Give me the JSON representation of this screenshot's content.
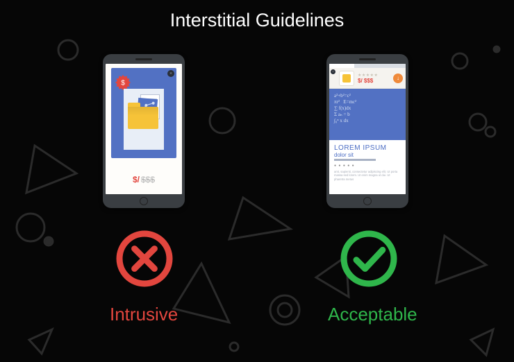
{
  "title": "Interstitial Guidelines",
  "intrusive": {
    "label": "Intrusive",
    "price_prefix": "$/",
    "price_struck": "$$$",
    "badge_symbol": "$"
  },
  "acceptable": {
    "label": "Acceptable",
    "banner_price": "$/ $$$",
    "banner_stars": "★★★★★",
    "headline": "LOREM IPSUM",
    "subhead": "dolor sit",
    "body": "amt, sapienti, consectetur adipiscing elit. Ut porta massa sed lorem. Ut enim magna ut dui. Ut pharetra metus",
    "chalk_lines": "a²+b²=c²\nπr²   E=mc²\n∑ f(x)dx\nΣ aₙ = b\n∫₀ⁿ x dx"
  },
  "colors": {
    "bad": "#e2463e",
    "good": "#2fb64b",
    "accent": "#5271c3",
    "folder": "#f6c338"
  }
}
